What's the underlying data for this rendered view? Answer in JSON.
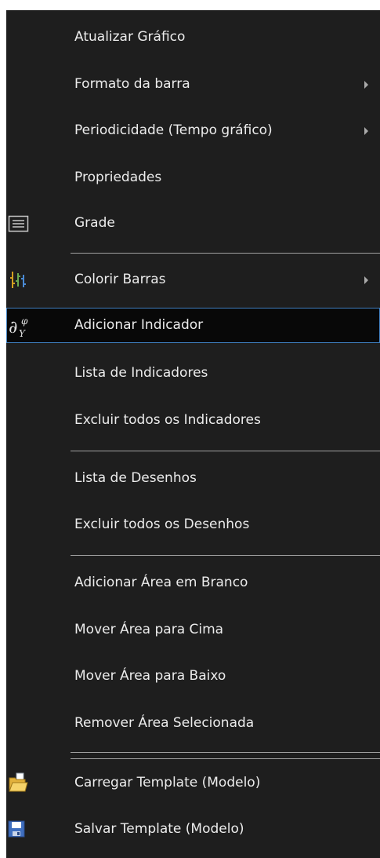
{
  "menu": {
    "items": [
      {
        "label": "Atualizar Gráfico",
        "submenu": false,
        "icon": null
      },
      {
        "label": "Formato da barra",
        "submenu": true,
        "icon": null
      },
      {
        "label": "Periodicidade (Tempo gráfico)",
        "submenu": true,
        "icon": null
      },
      {
        "label": "Propriedades",
        "submenu": false,
        "icon": null
      },
      {
        "label": "Grade",
        "submenu": false,
        "icon": "grid-lines-icon"
      },
      {
        "label": "Colorir Barras",
        "submenu": true,
        "icon": "color-bars-icon"
      },
      {
        "label": "Adicionar Indicador",
        "submenu": false,
        "icon": "indicator-formula-icon",
        "highlighted": true
      },
      {
        "label": "Lista de Indicadores",
        "submenu": false,
        "icon": null
      },
      {
        "label": "Excluir todos os Indicadores",
        "submenu": false,
        "icon": null
      },
      {
        "label": "Lista de Desenhos",
        "submenu": false,
        "icon": null
      },
      {
        "label": "Excluir todos os Desenhos",
        "submenu": false,
        "icon": null
      },
      {
        "label": "Adicionar Área em Branco",
        "submenu": false,
        "icon": null
      },
      {
        "label": "Mover Área para Cima",
        "submenu": false,
        "icon": null
      },
      {
        "label": "Mover Área para Baixo",
        "submenu": false,
        "icon": null
      },
      {
        "label": "Remover Área Selecionada",
        "submenu": false,
        "icon": null
      },
      {
        "label": "Carregar Template (Modelo)",
        "submenu": false,
        "icon": "open-folder-icon"
      },
      {
        "label": "Salvar Template (Modelo)",
        "submenu": false,
        "icon": "save-disk-icon"
      }
    ]
  },
  "colors": {
    "background": "#1e1e1e",
    "text": "#ececec",
    "highlight_background": "#080808",
    "highlight_border": "#3f7fc0",
    "separator": "#a0a0a0"
  }
}
